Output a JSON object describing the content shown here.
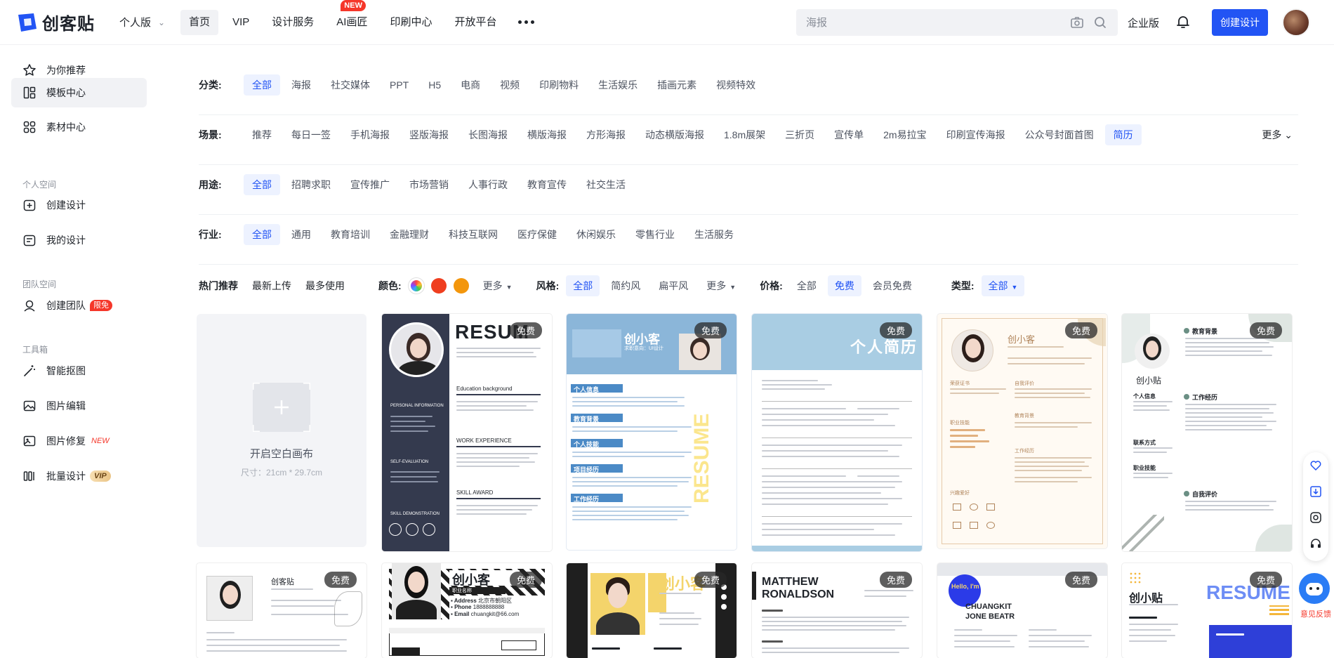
{
  "brand": {
    "name": "创客贴",
    "accent": "#2254f4",
    "danger": "#f5372a"
  },
  "topbar": {
    "edition": "个人版",
    "nav": [
      {
        "label": "首页",
        "active": true
      },
      {
        "label": "VIP"
      },
      {
        "label": "设计服务"
      },
      {
        "label": "AI画匠",
        "badge": "NEW"
      },
      {
        "label": "印刷中心"
      },
      {
        "label": "开放平台"
      }
    ],
    "search_placeholder": "海报",
    "enterprise": "企业版",
    "create_button": "创建设计"
  },
  "sidebar": {
    "items": [
      {
        "label": "为你推荐",
        "icon": "star-icon"
      },
      {
        "label": "模板中心",
        "icon": "template-icon",
        "active": true
      },
      {
        "label": "素材中心",
        "icon": "material-icon"
      }
    ],
    "personal_title": "个人空间",
    "personal": [
      {
        "label": "创建设计",
        "icon": "add-design-icon"
      },
      {
        "label": "我的设计",
        "icon": "my-design-icon"
      }
    ],
    "team_title": "团队空间",
    "team": [
      {
        "label": "创建团队",
        "icon": "team-icon",
        "tag": "限免"
      }
    ],
    "tools_title": "工具箱",
    "tools": [
      {
        "label": "智能抠图",
        "icon": "magic-wand-icon"
      },
      {
        "label": "图片编辑",
        "icon": "image-edit-icon"
      },
      {
        "label": "图片修复",
        "icon": "image-repair-icon",
        "tag": "NEW"
      },
      {
        "label": "批量设计",
        "icon": "batch-design-icon",
        "tag": "VIP"
      }
    ]
  },
  "filters": {
    "category": {
      "label": "分类:",
      "options": [
        "全部",
        "海报",
        "社交媒体",
        "PPT",
        "H5",
        "电商",
        "视频",
        "印刷物料",
        "生活娱乐",
        "插画元素",
        "视频特效"
      ],
      "selected": 0
    },
    "scene": {
      "label": "场景:",
      "options": [
        "推荐",
        "每日一签",
        "手机海报",
        "竖版海报",
        "长图海报",
        "横版海报",
        "方形海报",
        "动态横版海报",
        "1.8m展架",
        "三折页",
        "宣传单",
        "2m易拉宝",
        "印刷宣传海报",
        "公众号封面首图",
        "简历"
      ],
      "selected": 14,
      "more": "更多"
    },
    "usage": {
      "label": "用途:",
      "options": [
        "全部",
        "招聘求职",
        "宣传推广",
        "市场营销",
        "人事行政",
        "教育宣传",
        "社交生活"
      ],
      "selected": 0
    },
    "industry": {
      "label": "行业:",
      "options": [
        "全部",
        "通用",
        "教育培训",
        "金融理财",
        "科技互联网",
        "医疗保健",
        "休闲娱乐",
        "零售行业",
        "生活服务"
      ],
      "selected": 0
    }
  },
  "sortbar": {
    "sorts": [
      "热门推荐",
      "最新上传",
      "最多使用"
    ],
    "color_label": "颜色:",
    "colors": [
      "#ef3e1f",
      "#f3960c"
    ],
    "more": "更多",
    "style_label": "风格:",
    "styles": [
      "全部",
      "简约风",
      "扁平风"
    ],
    "style_selected": 0,
    "price_label": "价格:",
    "prices": [
      "全部",
      "免费",
      "会员免费"
    ],
    "price_selected": 1,
    "type_label": "类型:",
    "type_value": "全部"
  },
  "blank_canvas": {
    "title": "开启空白画布",
    "size": "尺寸：21cm * 29.7cm"
  },
  "free_badge": "免费",
  "templates": {
    "t1": {
      "heading": "RESUM",
      "sub1": "PERSONAL INFORMATION",
      "sub2": "Education background",
      "sub3": "WORK EXPERIENCE",
      "sub4": "SELF-EVALUATION",
      "sub5": "SKILL AWARD",
      "sub6": "SKILL DEMONSTRATION"
    },
    "t2": {
      "name": "创小客",
      "role": "求职意向：UI设计",
      "s1": "个人信息",
      "s2": "教育背景",
      "s3": "个人技能",
      "s4": "项目经历",
      "s5": "工作经历",
      "side": "RESUME"
    },
    "t3": {
      "title": "个人简历"
    },
    "t4": {
      "name": "创小客",
      "s1": "荣获证书",
      "s2": "自我评价",
      "s3": "职业技能",
      "s4": "教育背景",
      "s5": "工作经历",
      "s6": "兴趣爱好"
    },
    "t5": {
      "name": "创小贴",
      "s1": "教育背景",
      "s2": "工作经历",
      "s3": "个人信息",
      "s4": "联系方式",
      "s5": "职业技能",
      "s6": "自我评价"
    },
    "t6": {
      "name": "创客贴"
    },
    "t7": {
      "name": "创小客",
      "role": "职业名称",
      "addr_label": "Address",
      "addr": "北京市朝阳区",
      "phone_label": "Phone",
      "phone": "1888888888",
      "email_label": "Email",
      "email": "chuangkit@66.com"
    },
    "t8": {
      "name": "创小客"
    },
    "t9": {
      "name1": "MATTHEW",
      "name2": "RONALDSON"
    },
    "t10": {
      "hello": "Hello, I'm",
      "name1": "CHUANGKIT",
      "name2": "JONE BEATR"
    },
    "t11": {
      "name": "创小贴",
      "word": "RESUME"
    }
  },
  "helper": {
    "label": "意见反馈"
  }
}
